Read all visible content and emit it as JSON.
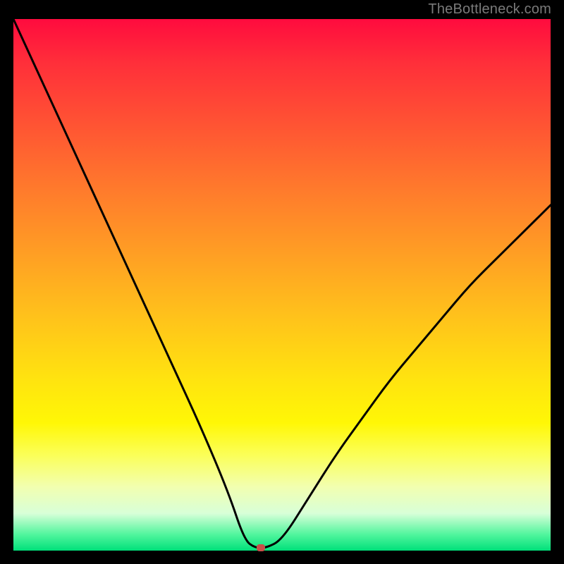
{
  "attribution": "TheBottleneck.com",
  "chart_data": {
    "type": "line",
    "title": "",
    "xlabel": "",
    "ylabel": "",
    "xlim": [
      0,
      100
    ],
    "ylim": [
      0,
      100
    ],
    "series": [
      {
        "name": "curve",
        "x": [
          0,
          5,
          10,
          15,
          20,
          25,
          30,
          35,
          40,
          43,
          45,
          47,
          50,
          55,
          60,
          65,
          70,
          75,
          80,
          85,
          90,
          95,
          100
        ],
        "y": [
          100,
          89,
          78,
          67,
          56,
          45,
          34,
          23,
          11,
          2,
          0.5,
          0.5,
          2,
          10,
          18,
          25,
          32,
          38,
          44,
          50,
          55,
          60,
          65
        ]
      }
    ],
    "marker": {
      "x": 46,
      "y": 0.5
    },
    "background_gradient": {
      "type": "vertical",
      "stops": [
        {
          "pos": 0,
          "color": "#ff0b3e"
        },
        {
          "pos": 50,
          "color": "#ffbf1e"
        },
        {
          "pos": 80,
          "color": "#fff94a"
        },
        {
          "pos": 100,
          "color": "#00e07a"
        }
      ]
    }
  }
}
